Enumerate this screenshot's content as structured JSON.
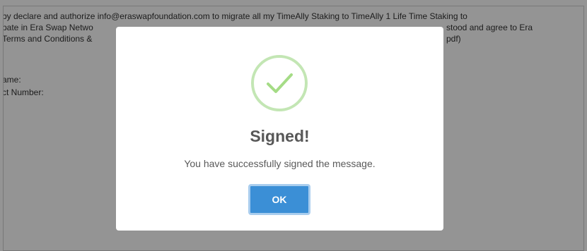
{
  "background": {
    "message_lines": [
      "by declare and authorize info@eraswapfoundation.com to migrate all my TimeAlly Staking to TimeAlly 1 Life Time Staking to",
      "pate in Era Swap Netwo",
      "Terms and Conditions &",
      "",
      "ame:",
      "ct Number:"
    ],
    "hidden_tail_2": "stood and agree to Era",
    "hidden_tail_3": "pdf)"
  },
  "modal": {
    "icon": "success-checkmark-icon",
    "title": "Signed!",
    "text": "You have successfully signed the message.",
    "ok_label": "OK"
  },
  "colors": {
    "overlay": "#6b6b6b",
    "check": "#a5dc86",
    "check_ring": "#c3e6b4",
    "button": "#3b8fd6",
    "button_border": "#a9cdee"
  }
}
